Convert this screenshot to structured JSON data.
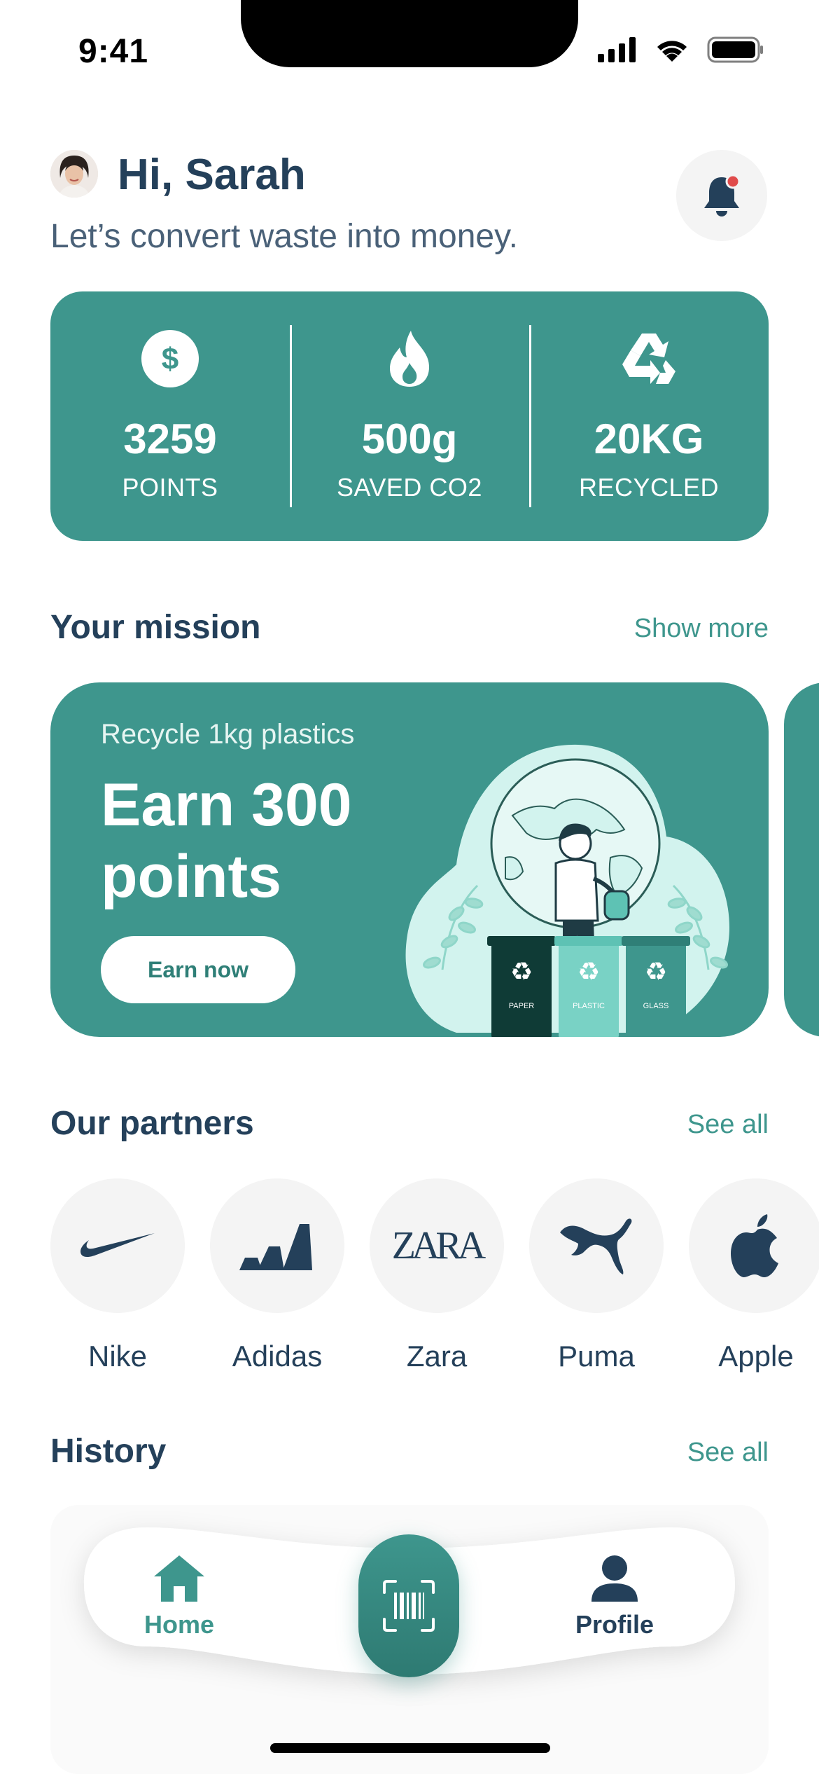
{
  "status_bar": {
    "time": "9:41"
  },
  "header": {
    "greeting": "Hi, Sarah",
    "subtitle": "Let’s convert waste into money."
  },
  "stats": [
    {
      "icon": "dollar-icon",
      "value": "3259",
      "label": "POINTS"
    },
    {
      "icon": "flame-icon",
      "value": "500g",
      "label": "SAVED CO2"
    },
    {
      "icon": "recycle-icon",
      "value": "20KG",
      "label": "RECYCLED"
    }
  ],
  "mission": {
    "title": "Your mission",
    "link": "Show more",
    "card": {
      "subtitle": "Recycle 1kg plastics",
      "headline": "Earn 300 points",
      "button": "Earn now",
      "bins": [
        "PAPER",
        "PLASTIC",
        "GLASS"
      ]
    }
  },
  "partners": {
    "title": "Our partners",
    "link": "See all",
    "items": [
      {
        "name": "Nike",
        "logo": "nike-logo"
      },
      {
        "name": "Adidas",
        "logo": "adidas-logo"
      },
      {
        "name": "Zara",
        "logo": "zara-logo",
        "wordmark": "ZARA"
      },
      {
        "name": "Puma",
        "logo": "puma-logo"
      },
      {
        "name": "Apple",
        "logo": "apple-logo"
      }
    ]
  },
  "history": {
    "title": "History",
    "link": "See all"
  },
  "nav": {
    "home": "Home",
    "profile": "Profile"
  },
  "colors": {
    "accent": "#3e968d",
    "text": "#24405a",
    "notification": "#e04b4b"
  }
}
